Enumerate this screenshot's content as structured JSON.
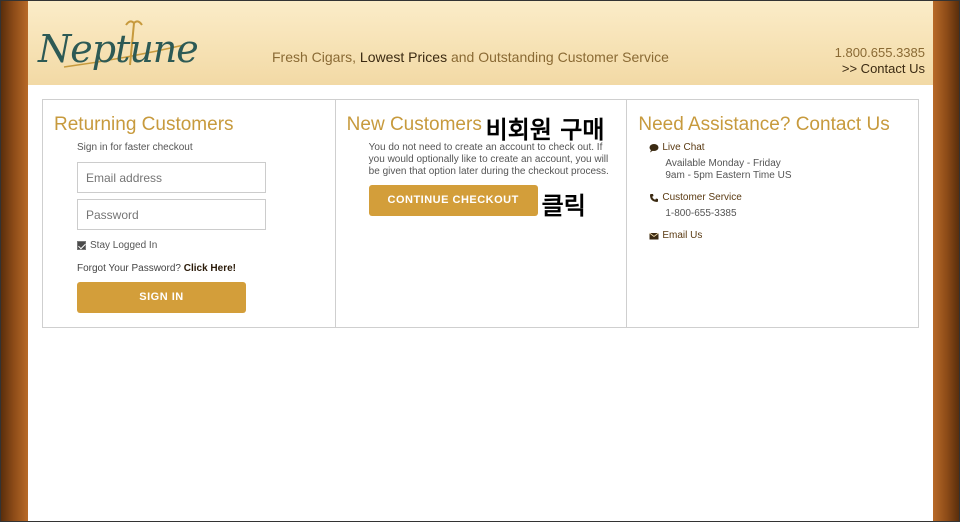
{
  "header": {
    "logo_text": "Neptune",
    "tagline_part1": "Fresh Cigars, ",
    "tagline_part2": "Lowest Prices",
    "tagline_part3": " and Outstanding Customer Service",
    "phone": "1.800.655.3385",
    "contact_link": ">> Contact Us"
  },
  "returning": {
    "title": "Returning Customers",
    "subtitle": "Sign in for faster checkout",
    "email_placeholder": "Email address",
    "password_placeholder": "Password",
    "stay_logged_in": "Stay Logged In",
    "forgot_text": "Forgot Your Password? ",
    "forgot_link": "Click Here!",
    "sign_in_label": "SIGN IN"
  },
  "new_customers": {
    "title": "New Customers",
    "annotation_title": "비회원 구매",
    "description": "You do not need to create an account to check out. If you would optionally like to create an account, you will be given that option later during the checkout process.",
    "continue_label": "CONTINUE CHECKOUT",
    "annotation_click": "클릭"
  },
  "assistance": {
    "title": "Need Assistance? Contact Us",
    "live_chat": "Live Chat",
    "live_chat_hours_1": "Available Monday - Friday",
    "live_chat_hours_2": "9am - 5pm Eastern Time US",
    "customer_service": "Customer Service",
    "customer_service_phone": "1-800-655-3385",
    "email_us": "Email Us"
  },
  "colors": {
    "accent": "#d39e3a",
    "heading": "#c79a3d",
    "side_bar": "#8b4a17"
  }
}
